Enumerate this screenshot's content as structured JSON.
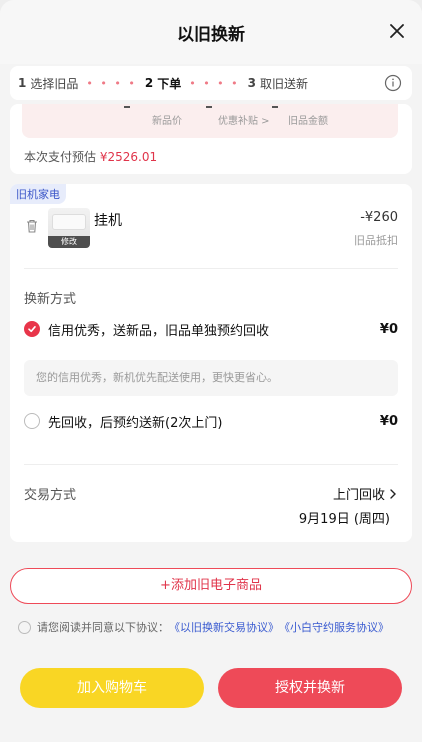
{
  "header": {
    "title": "以旧换新"
  },
  "steps": [
    {
      "num": "1",
      "label": "选择旧品"
    },
    {
      "num": "2",
      "label": "下单"
    },
    {
      "num": "3",
      "label": "取旧送新"
    }
  ],
  "summary": {
    "labels": [
      "新品价",
      "优惠补贴 >",
      "旧品金额"
    ],
    "estimate_label": "本次支付预估",
    "estimate_amount": "¥2526.01"
  },
  "product": {
    "tag": "旧机家电",
    "thumb_edit": "修改",
    "name": "挂机",
    "price": "-¥260",
    "sub": "旧品抵扣"
  },
  "exchange": {
    "title": "换新方式",
    "options": [
      {
        "label": "信用优秀，送新品，旧品单独预约回收",
        "price": "¥0",
        "selected": true
      },
      {
        "label": "先回收，后预约送新(2次上门)",
        "price": "¥0",
        "selected": false
      }
    ],
    "note": "您的信用优秀，新机优先配送使用，更快更省心。"
  },
  "trade": {
    "title": "交易方式",
    "method": "上门回收",
    "date": "9月19日 (周四)"
  },
  "add_button": "+添加旧电子商品",
  "agreement": {
    "prefix": "请您阅读并同意以下协议：",
    "link1": "《以旧换新交易协议》",
    "link2": "《小白守约服务协议》"
  },
  "footer": {
    "cart_label": "加入购物车",
    "confirm_label": "授权并换新"
  },
  "colors": {
    "accent_red": "#ee4a58",
    "yellow": "#f9d624",
    "link_blue": "#3a5bd0"
  },
  "icons": [
    "close-icon",
    "info-icon",
    "trash-icon",
    "check-icon",
    "chevron-right-icon"
  ]
}
